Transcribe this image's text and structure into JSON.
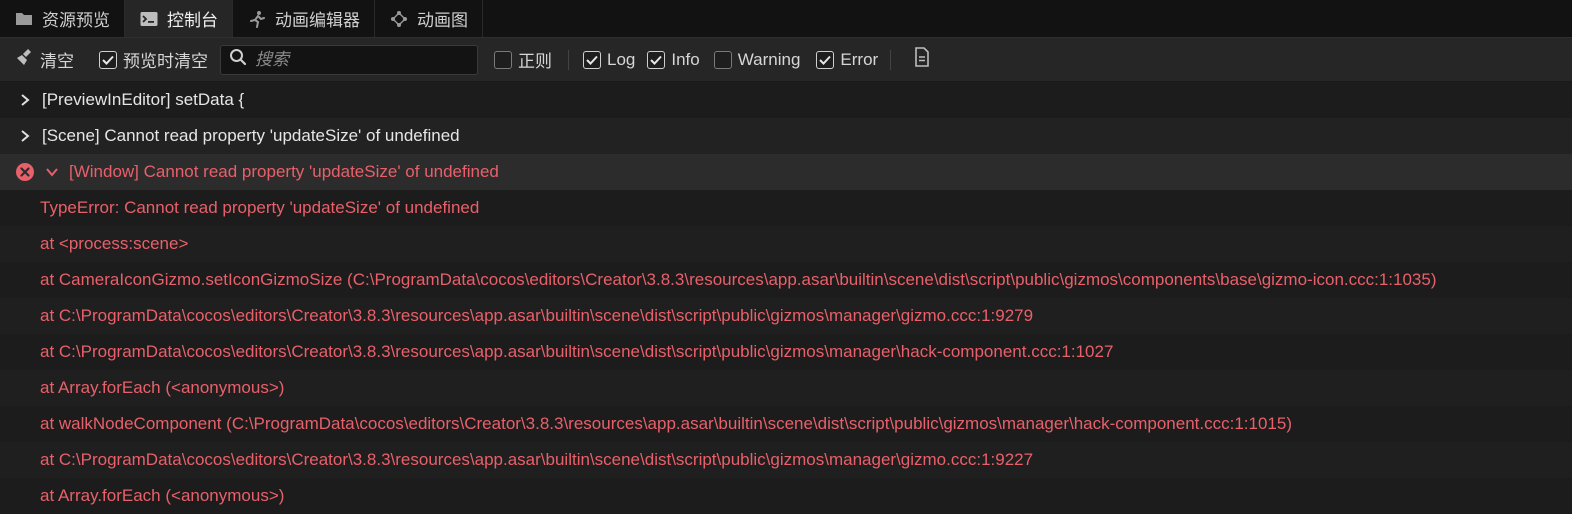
{
  "tabs": [
    {
      "label": "资源预览",
      "icon": "folder-icon",
      "active": false
    },
    {
      "label": "控制台",
      "icon": "terminal-icon",
      "active": true
    },
    {
      "label": "动画编辑器",
      "icon": "running-figure-icon",
      "active": false
    },
    {
      "label": "动画图",
      "icon": "animation-graph-icon",
      "active": false
    }
  ],
  "toolbar": {
    "clear_label": "清空",
    "clear_on_preview_label": "预览时清空",
    "clear_on_preview_checked": true,
    "search_placeholder": "搜索",
    "search_value": "",
    "regex_label": "正则",
    "regex_checked": false,
    "log_label": "Log",
    "log_checked": true,
    "info_label": "Info",
    "info_checked": true,
    "warning_label": "Warning",
    "warning_checked": false,
    "error_label": "Error",
    "error_checked": true
  },
  "logs": [
    {
      "type": "log",
      "text": "[PreviewInEditor] setData {",
      "expanded": false
    },
    {
      "type": "log",
      "text": "[Scene] Cannot read property 'updateSize' of undefined",
      "expanded": false
    },
    {
      "type": "error",
      "text": "[Window] Cannot read property 'updateSize' of undefined",
      "expanded": true
    }
  ],
  "stack": [
    "TypeError: Cannot read property 'updateSize' of undefined",
    "at <process:scene>",
    "at CameraIconGizmo.setIconGizmoSize (C:\\ProgramData\\cocos\\editors\\Creator\\3.8.3\\resources\\app.asar\\builtin\\scene\\dist\\script\\public\\gizmos\\components\\base\\gizmo-icon.ccc:1:1035)",
    "at C:\\ProgramData\\cocos\\editors\\Creator\\3.8.3\\resources\\app.asar\\builtin\\scene\\dist\\script\\public\\gizmos\\manager\\gizmo.ccc:1:9279",
    "at C:\\ProgramData\\cocos\\editors\\Creator\\3.8.3\\resources\\app.asar\\builtin\\scene\\dist\\script\\public\\gizmos\\manager\\hack-component.ccc:1:1027",
    "at Array.forEach (<anonymous>)",
    "at walkNodeComponent (C:\\ProgramData\\cocos\\editors\\Creator\\3.8.3\\resources\\app.asar\\builtin\\scene\\dist\\script\\public\\gizmos\\manager\\hack-component.ccc:1:1015)",
    "at C:\\ProgramData\\cocos\\editors\\Creator\\3.8.3\\resources\\app.asar\\builtin\\scene\\dist\\script\\public\\gizmos\\manager\\gizmo.ccc:1:9227",
    "at Array.forEach (<anonymous>)"
  ],
  "colors": {
    "error_red": "#e8606a",
    "background": "#1c1c1c",
    "toolbar_bg": "#262626",
    "tab_bar_bg": "#121212"
  }
}
